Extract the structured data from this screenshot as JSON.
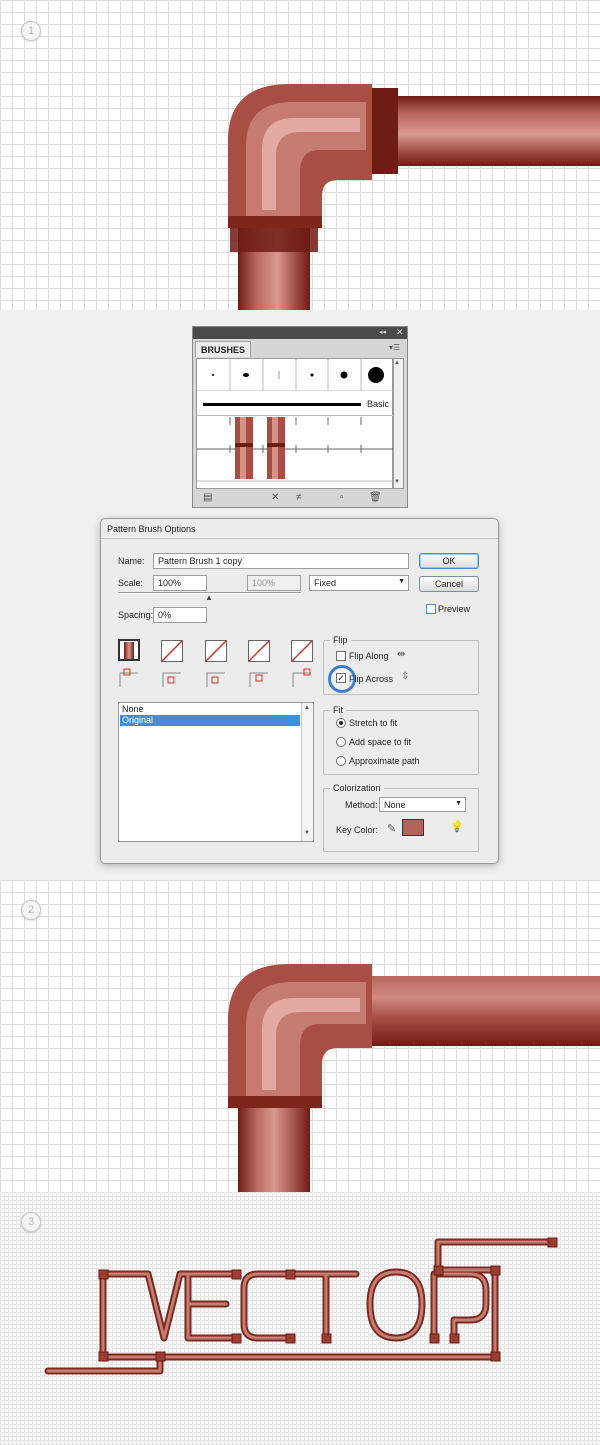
{
  "steps": [
    "1",
    "2",
    "3"
  ],
  "brushes_panel": {
    "tab_label": "BRUSHES",
    "collapse_glyph": "◂◂",
    "close_glyph": "✕",
    "menu_glyph": "▾☰",
    "basic_label": "Basic"
  },
  "dialog": {
    "title": "Pattern Brush Options",
    "name_label": "Name:",
    "name_value": "Pattern Brush 1 copy",
    "scale_label": "Scale:",
    "scale_value": "100%",
    "scale_max_value": "100%",
    "scale_mode": "Fixed",
    "spacing_label": "Spacing:",
    "spacing_value": "0%",
    "ok_label": "OK",
    "cancel_label": "Cancel",
    "preview_label": "Preview",
    "preview_checked": false,
    "pattern_list": [
      {
        "label": "None",
        "selected": false
      },
      {
        "label": "Original",
        "selected": true
      }
    ],
    "flip": {
      "title": "Flip",
      "flip_along_label": "Flip Along",
      "flip_along_checked": false,
      "flip_across_label": "Flip Across",
      "flip_across_checked": true
    },
    "fit": {
      "title": "Fit",
      "options": [
        {
          "label": "Stretch to fit",
          "selected": true
        },
        {
          "label": "Add space to fit",
          "selected": false
        },
        {
          "label": "Approximate path",
          "selected": false
        }
      ]
    },
    "colorization": {
      "title": "Colorization",
      "method_label": "Method:",
      "method_value": "None",
      "key_color_label": "Key Color:",
      "key_color": "#b5625a"
    }
  },
  "colors": {
    "pipe_dark": "#6e1c14",
    "pipe_mid": "#a94e44",
    "pipe_light": "#d08a80",
    "highlight_ring": "#3a7fd0",
    "selection": "#3d8fe6"
  }
}
